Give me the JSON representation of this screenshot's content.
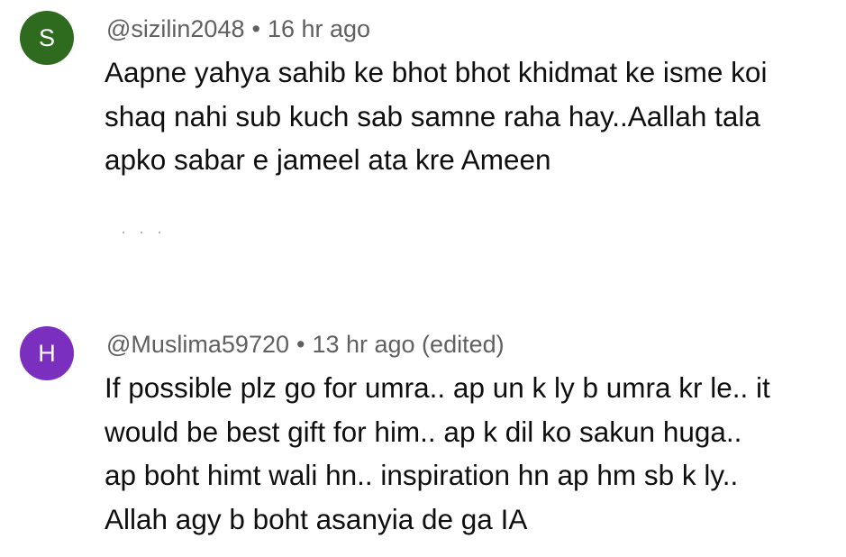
{
  "comments": [
    {
      "avatar_letter": "S",
      "avatar_color": "#2e6b1f",
      "handle": "@sizilin2048",
      "separator": "•",
      "time": "16 hr ago",
      "text": "Aapne yahya sahib ke bhot bhot khidmat ke isme koi\nshaq nahi sub kuch sab samne raha hay..Aallah tala\napko sabar e jameel ata kre Ameen"
    },
    {
      "avatar_letter": "H",
      "avatar_color": "#7b2fbe",
      "handle": "@Muslima59720",
      "separator": "•",
      "time": "13 hr ago (edited)",
      "text": "If possible plz go for umra.. ap un k ly b umra kr le.. it\nwould be best gift for him.. ap k dil ko sakun huga..\nap boht himt wali hn.. inspiration hn ap hm sb k ly..\nAllah agy b boht asanyia de ga IA"
    }
  ]
}
